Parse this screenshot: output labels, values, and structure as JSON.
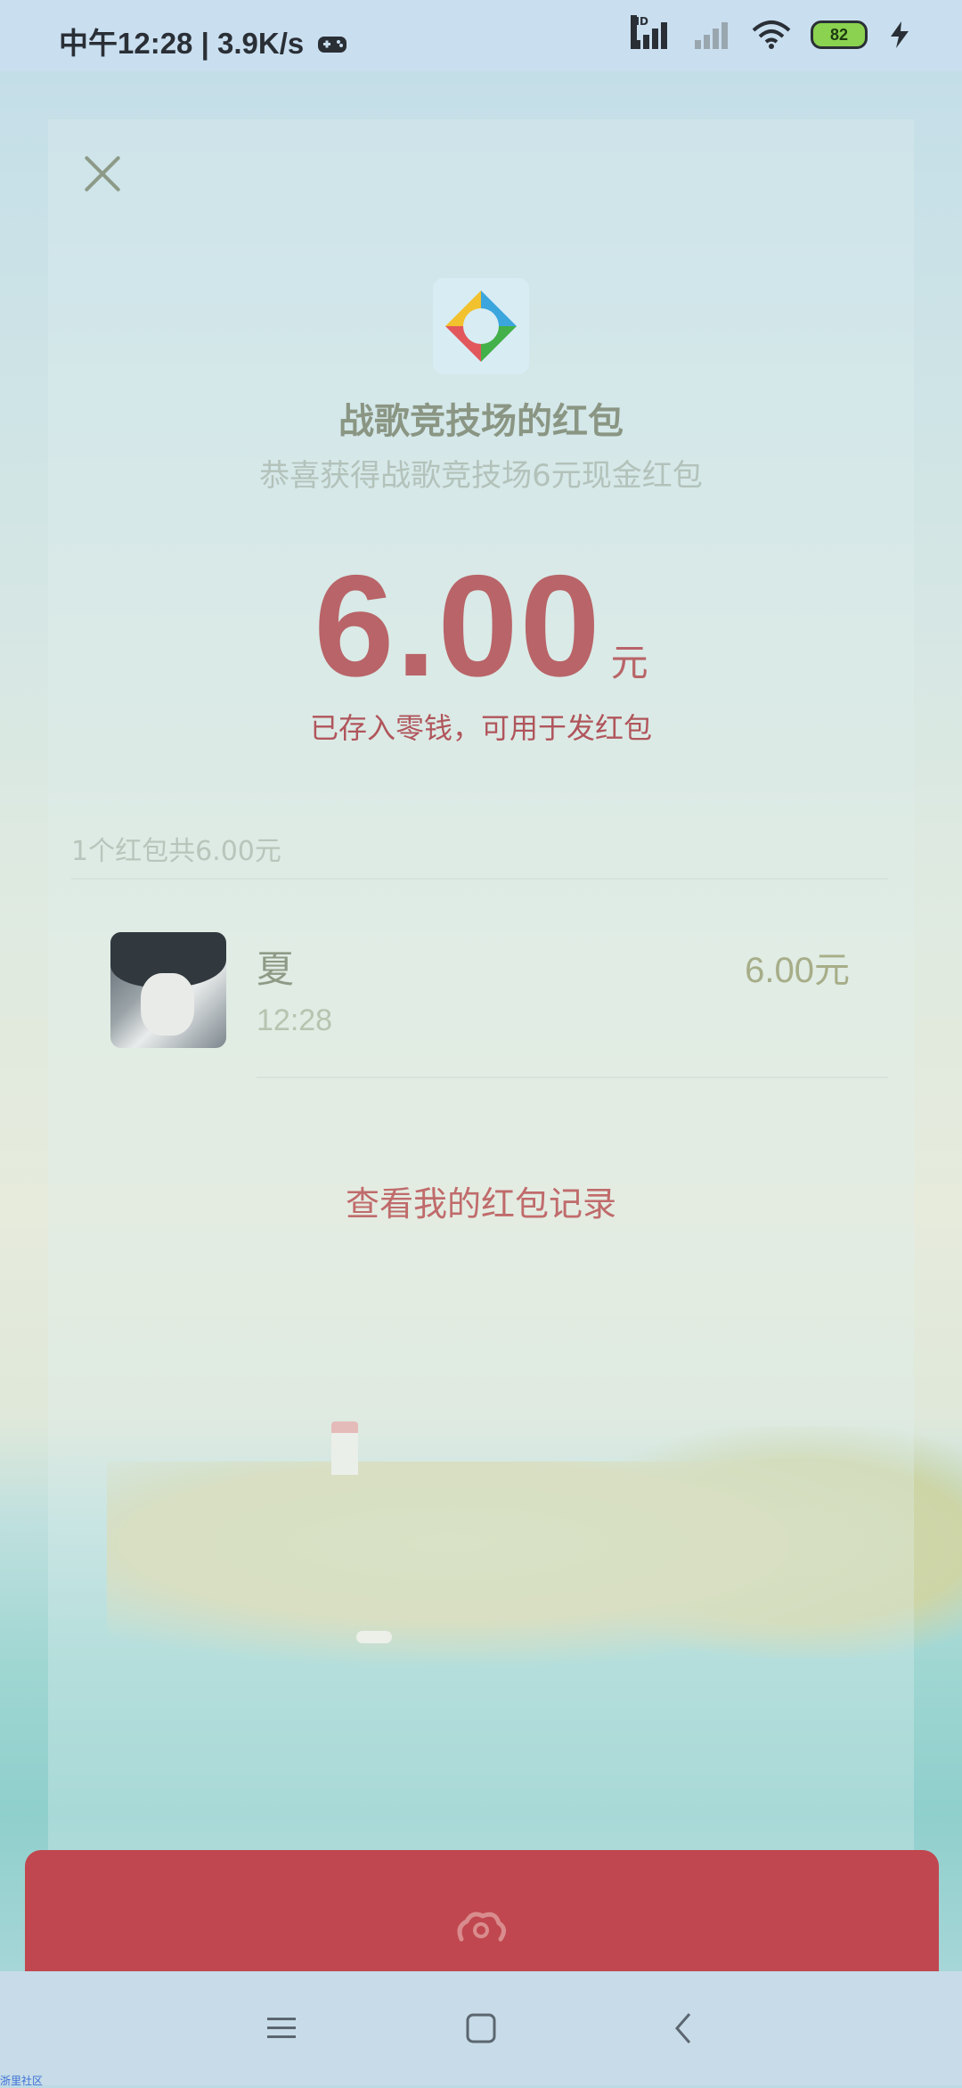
{
  "status_bar": {
    "time_label": "中午12:28",
    "speed": "3.9K/s",
    "network_type": "HD",
    "battery_level": "82",
    "icons": [
      "game-controller-icon",
      "signal-icon",
      "signal-dim-icon",
      "wifi-icon",
      "battery-icon",
      "charging-icon"
    ]
  },
  "red_packet": {
    "sender": "战歌竞技场的红包",
    "blessing": "恭喜获得战歌竞技场6元现金红包",
    "amount": "6.00",
    "currency_unit": "元",
    "deposit_note": "已存入零钱，可用于发红包",
    "summary": "1个红包共6.00元",
    "colors": {
      "accent": "#b96468",
      "envelope": "#c0474f"
    }
  },
  "receivers": [
    {
      "name": "夏",
      "time": "12:28",
      "amount": "6.00元"
    }
  ],
  "actions": {
    "history_link": "查看我的红包记录"
  },
  "navigation": {
    "buttons": [
      "menu-icon",
      "home-icon",
      "back-icon"
    ]
  },
  "watermark": "浙里社区"
}
